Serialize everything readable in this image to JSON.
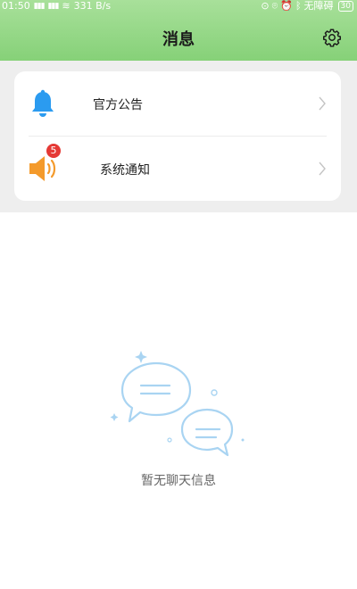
{
  "status_bar": {
    "time": "01:50",
    "speed": "331 B/s",
    "accessibility": "无障碍",
    "battery": "30"
  },
  "header": {
    "title": "消息"
  },
  "list": {
    "items": [
      {
        "label": "官方公告",
        "icon": "bell-icon"
      },
      {
        "label": "系统通知",
        "icon": "speaker-icon",
        "badge": "5"
      }
    ]
  },
  "empty_state": {
    "text": "暂无聊天信息"
  },
  "colors": {
    "header_top": "#a8e09a",
    "header_bottom": "#86d178",
    "bell": "#2b9bf0",
    "speaker": "#f49a2b",
    "badge": "#e53935"
  }
}
